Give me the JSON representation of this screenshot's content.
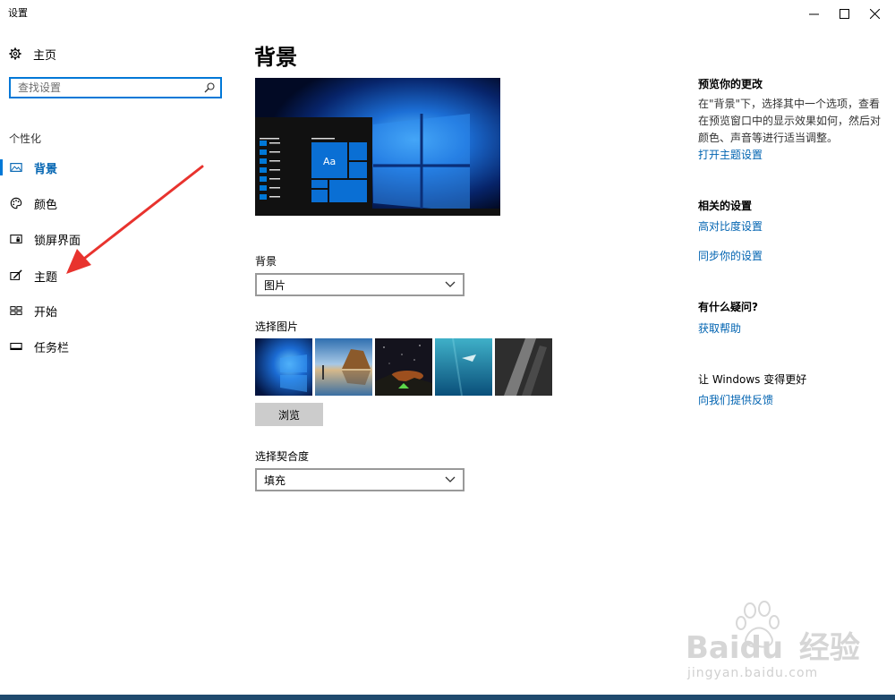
{
  "window": {
    "title": "设置"
  },
  "sidebar": {
    "home_label": "主页",
    "search_placeholder": "查找设置",
    "section_label": "个性化",
    "items": [
      {
        "label": "背景",
        "icon": "image-icon",
        "active": true
      },
      {
        "label": "颜色",
        "icon": "palette-icon",
        "active": false
      },
      {
        "label": "锁屏界面",
        "icon": "lock-screen-icon",
        "active": false
      },
      {
        "label": "主题",
        "icon": "theme-brush-icon",
        "active": false
      },
      {
        "label": "开始",
        "icon": "start-tiles-icon",
        "active": false
      },
      {
        "label": "任务栏",
        "icon": "taskbar-icon",
        "active": false
      }
    ]
  },
  "main": {
    "title": "背景",
    "preview_tile_text": "Aa",
    "background_label": "背景",
    "background_value": "图片",
    "choose_picture_label": "选择图片",
    "browse_label": "浏览",
    "fit_label": "选择契合度",
    "fit_value": "填充"
  },
  "right_panel": {
    "preview_heading": "预览你的更改",
    "preview_text": "在\"背景\"下，选择其中一个选项，查看在预览窗口中的显示效果如何，然后对颜色、声音等进行适当调整。",
    "open_theme_link": "打开主题设置",
    "related_heading": "相关的设置",
    "high_contrast_link": "高对比度设置",
    "sync_link": "同步你的设置",
    "question_heading": "有什么疑问?",
    "help_link": "获取帮助",
    "improve_heading": "让 Windows 变得更好",
    "feedback_link": "向我们提供反馈"
  },
  "watermark": {
    "brand": "Baidu",
    "cn": "经验",
    "url": "jingyan.baidu.com"
  },
  "colors": {
    "accent": "#0078d7",
    "link": "#0063b1",
    "annotation_arrow": "#e8332e"
  }
}
